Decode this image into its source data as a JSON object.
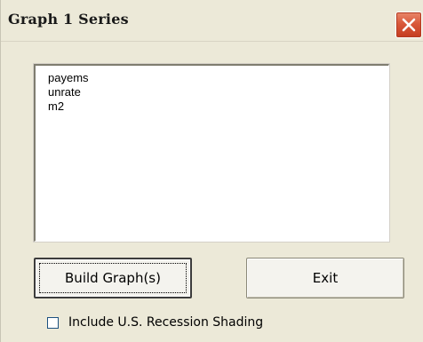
{
  "window": {
    "title": "Graph 1 Series"
  },
  "series_list": {
    "items": [
      "payems",
      "unrate",
      "m2"
    ]
  },
  "buttons": {
    "build_label": "Build Graph(s)",
    "exit_label": "Exit"
  },
  "options": {
    "recession_shading_label": "Include U.S. Recession Shading",
    "recession_shading_checked": false
  },
  "icons": {
    "close": "close-icon"
  },
  "colors": {
    "dialog_background": "#ece9d8",
    "close_button": "#d9583a"
  }
}
